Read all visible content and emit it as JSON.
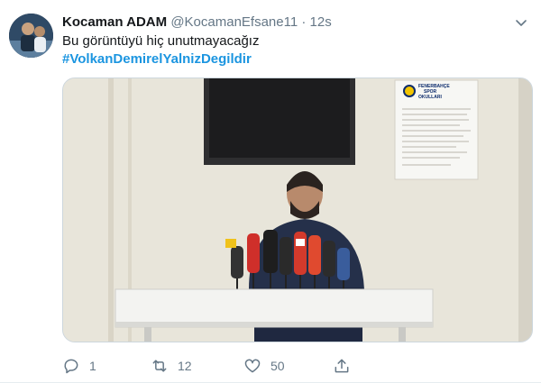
{
  "tweet": {
    "display_name": "Kocaman ADAM",
    "handle": "@KocamanEfsane11",
    "separator": "·",
    "time": "12s",
    "text": "Bu görüntüyü hiç unutmayacağız",
    "hashtag": "#VolkanDemirelYalnizDegildir"
  },
  "media": {
    "poster": {
      "title_line1": "FENERBAHÇE",
      "title_line2": "SPOR",
      "title_line3": "OKULLARI"
    }
  },
  "actions": {
    "reply_count": "1",
    "retweet_count": "12",
    "like_count": "50"
  },
  "colors": {
    "link": "#1b95e0",
    "secondary": "#657786",
    "primary_text": "#14171a"
  },
  "icons": [
    "chevron-down-icon",
    "reply-icon",
    "retweet-icon",
    "like-icon",
    "share-icon"
  ]
}
